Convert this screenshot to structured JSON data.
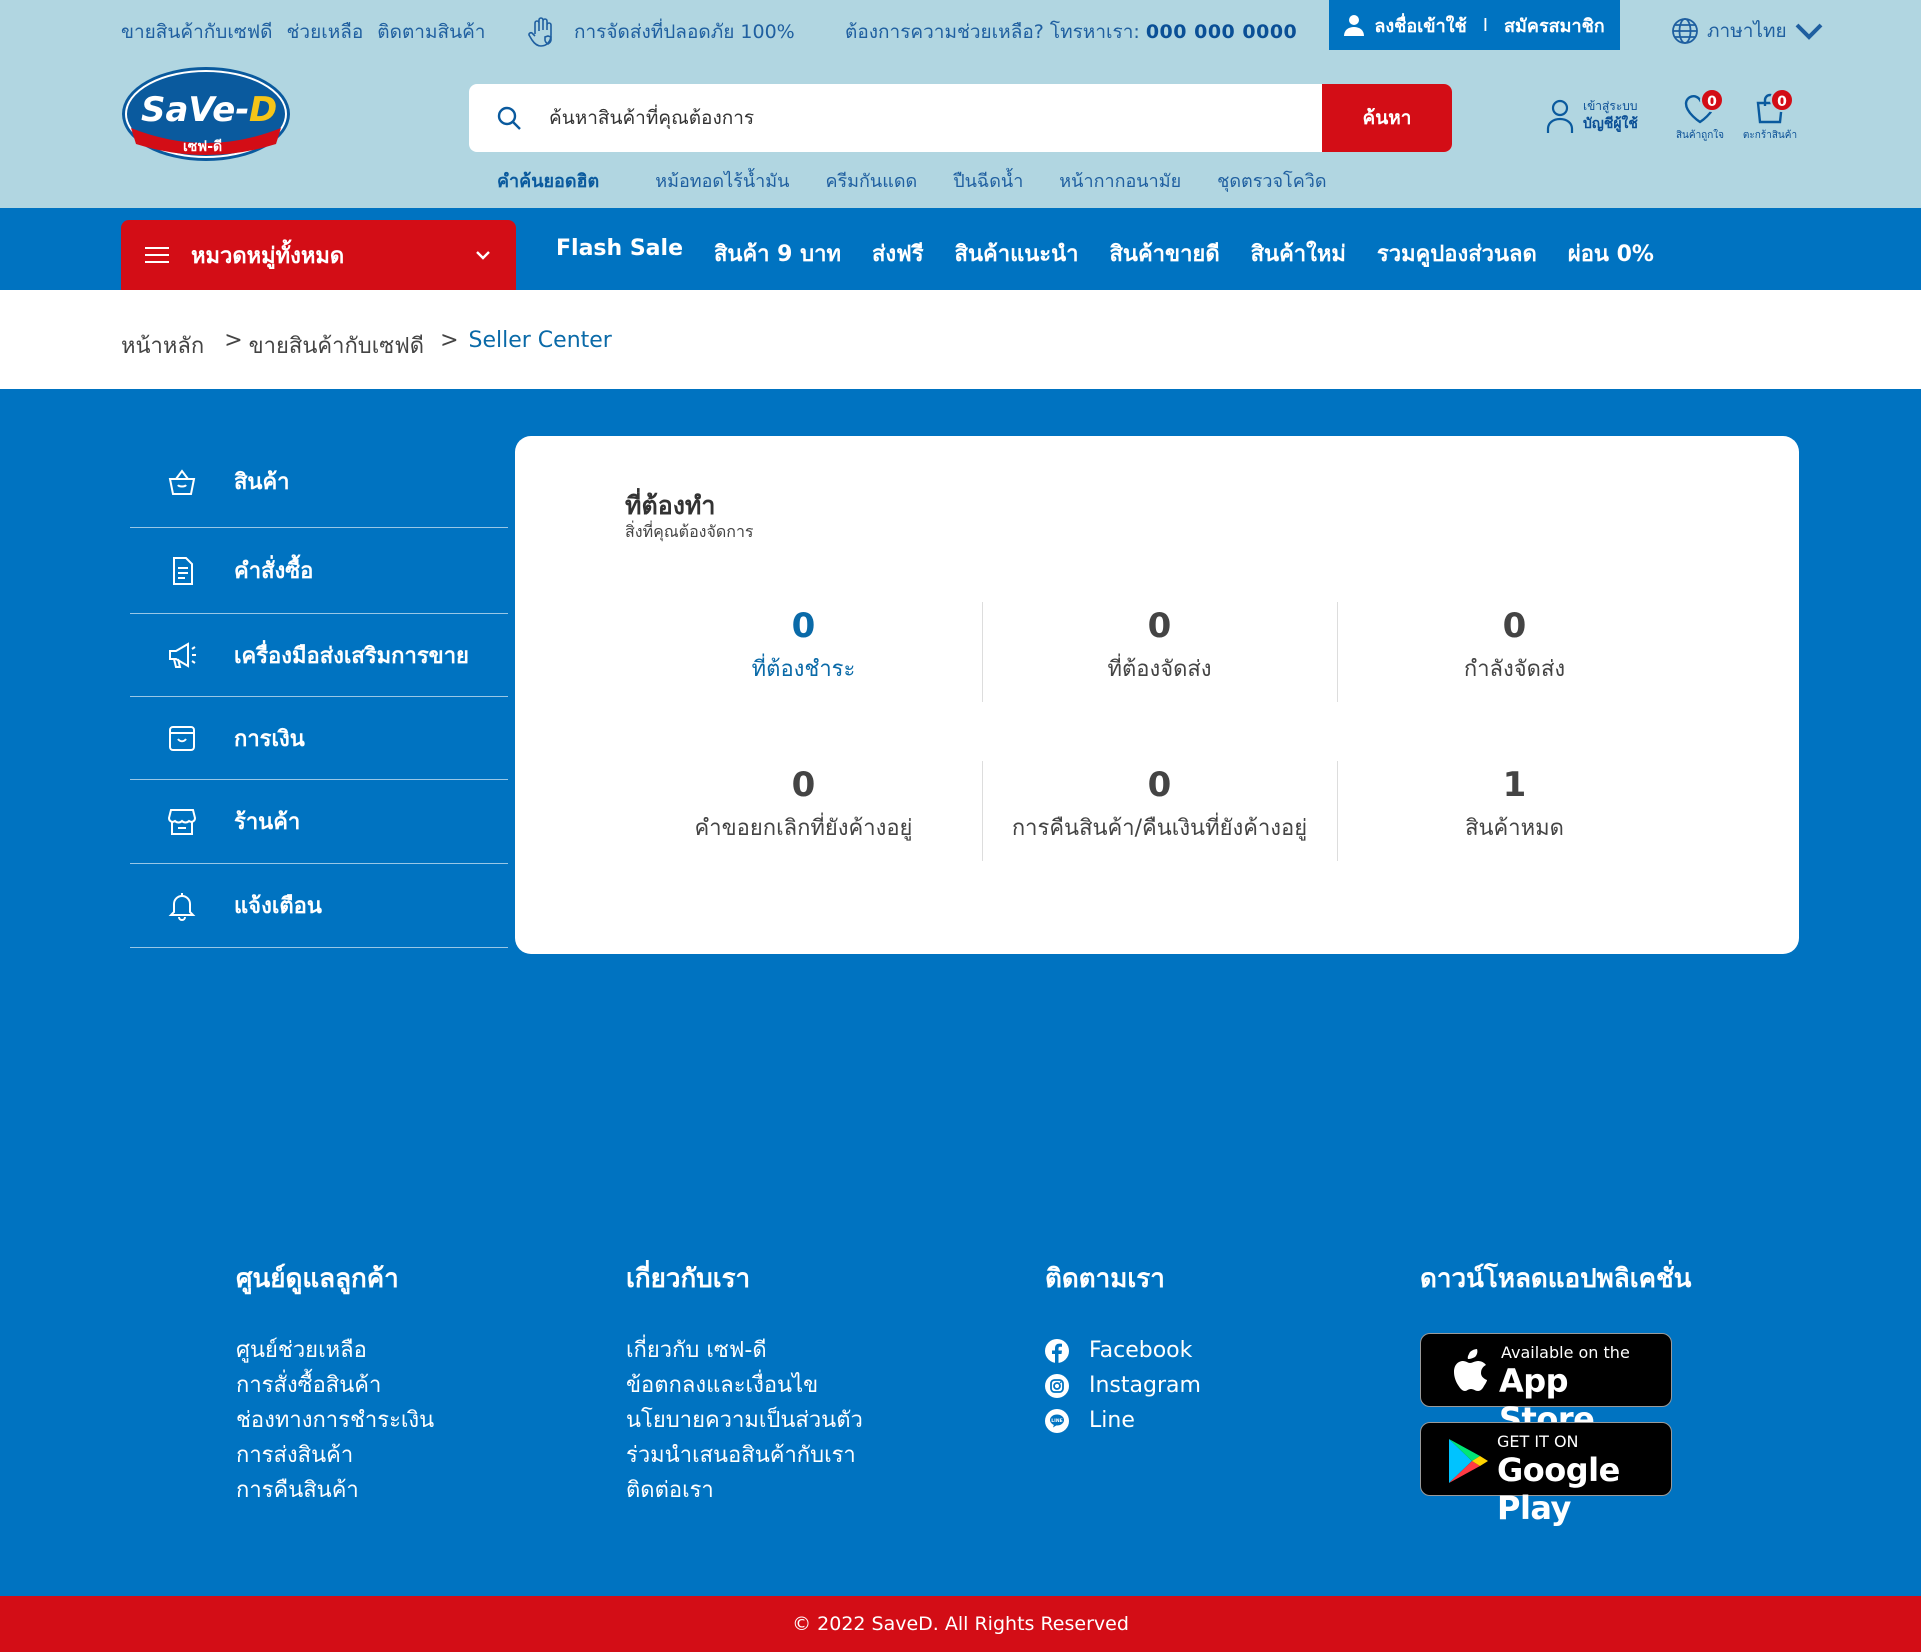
{
  "topbar": {
    "links": [
      "ขายสินค้ากับเซฟดี",
      "ช่วยเหลือ",
      "ติดตามสินค้า"
    ],
    "safe_delivery": "การจัดส่งที่ปลอดภัย 100%",
    "help_text": "ต้องการความช่วยเหลือ? โทรหาเรา:",
    "phone": "000 000 0000",
    "login_label": "ลงชื่อเข้าใช้",
    "login_sep": "I",
    "register_label": "สมัครสมาชิก",
    "language": "ภาษาไทย"
  },
  "logo": {
    "brand": "SaVe-D",
    "sub": "เซฟ-ดี"
  },
  "search": {
    "placeholder": "ค้นหาสินค้าที่คุณต้องการ",
    "button": "ค้นหา",
    "hot_title": "คำค้นยอดฮิต",
    "hot_terms": [
      "หม้อทอดไร้น้ำมัน",
      "ครีมกันแดด",
      "ปืนฉีดน้ำ",
      "หน้ากากอนามัย",
      "ชุดตรวจโควิด"
    ]
  },
  "account": {
    "line1": "เข้าสู่ระบบ",
    "line2": "บัญชีผู้ใช้"
  },
  "wishlist": {
    "label": "สินค้าถูกใจ",
    "count": "0"
  },
  "cart": {
    "label": "ตะกร้าสินค้า",
    "count": "0"
  },
  "nav": {
    "categories_label": "หมวดหมู่ทั้งหมด",
    "items": [
      "Flash Sale",
      "สินค้า 9 บาท",
      "ส่งฟรี",
      "สินค้าแนะนำ",
      "สินค้าขายดี",
      "สินค้าใหม่",
      "รวมคูปองส่วนลด",
      "ผ่อน 0%"
    ]
  },
  "breadcrumb": {
    "home": "หน้าหลัก",
    "sep": ">",
    "level2": "ขายสินค้ากับเซฟดี",
    "current": "Seller Center"
  },
  "sidebar": {
    "items": [
      {
        "label": "สินค้า",
        "icon": "basket-icon"
      },
      {
        "label": "คำสั่งซื้อ",
        "icon": "order-list-icon"
      },
      {
        "label": "เครื่องมือส่งเสริมการขาย",
        "icon": "megaphone-icon"
      },
      {
        "label": "การเงิน",
        "icon": "wallet-icon"
      },
      {
        "label": "ร้านค้า",
        "icon": "shop-icon"
      },
      {
        "label": "แจ้งเตือน",
        "icon": "bell-icon"
      }
    ]
  },
  "todo": {
    "title": "ที่ต้องทำ",
    "subtitle": "สิ่งที่คุณต้องจัดการ",
    "stats": [
      {
        "value": "0",
        "label": "ที่ต้องชำระ"
      },
      {
        "value": "0",
        "label": "ที่ต้องจัดส่ง"
      },
      {
        "value": "0",
        "label": "กำลังจัดส่ง"
      },
      {
        "value": "0",
        "label": "คำขอยกเลิกที่ยังค้างอยู่"
      },
      {
        "value": "0",
        "label": "การคืนสินค้า/คืนเงินที่ยังค้างอยู่"
      },
      {
        "value": "1",
        "label": "สินค้าหมด"
      }
    ]
  },
  "footer": {
    "customer_care": {
      "title": "ศูนย์ดูแลลูกค้า",
      "links": [
        "ศูนย์ช่วยเหลือ",
        "การสั่งซื้อสินค้า",
        "ช่องทางการชำระเงิน",
        "การส่งสินค้า",
        "การคืนสินค้า"
      ]
    },
    "about": {
      "title": "เกี่ยวกับเรา",
      "links": [
        "เกี่ยวกับ เซฟ-ดี",
        "ข้อตกลงและเงื่อนไข",
        "นโยบายความเป็นส่วนตัว",
        "ร่วมนำเสนอสินค้ากับเรา",
        "ติดต่อเรา"
      ]
    },
    "follow": {
      "title": "ติดตามเรา",
      "links": [
        "Facebook",
        "Instagram",
        "Line"
      ]
    },
    "download": {
      "title": "ดาวน์โหลดแอปพลิเคชั่น",
      "appstore_small": "Available on the",
      "appstore_big": "App Store",
      "googleplay_small": "GET IT ON",
      "googleplay_big": "Google Play"
    },
    "copyright": "© 2022 SaveD. All Rights Reserved"
  },
  "colors": {
    "primary_blue": "#0073c1",
    "header_bg": "#b1d6e1",
    "accent_red": "#d30d16",
    "link_blue": "#0a6aa8"
  }
}
